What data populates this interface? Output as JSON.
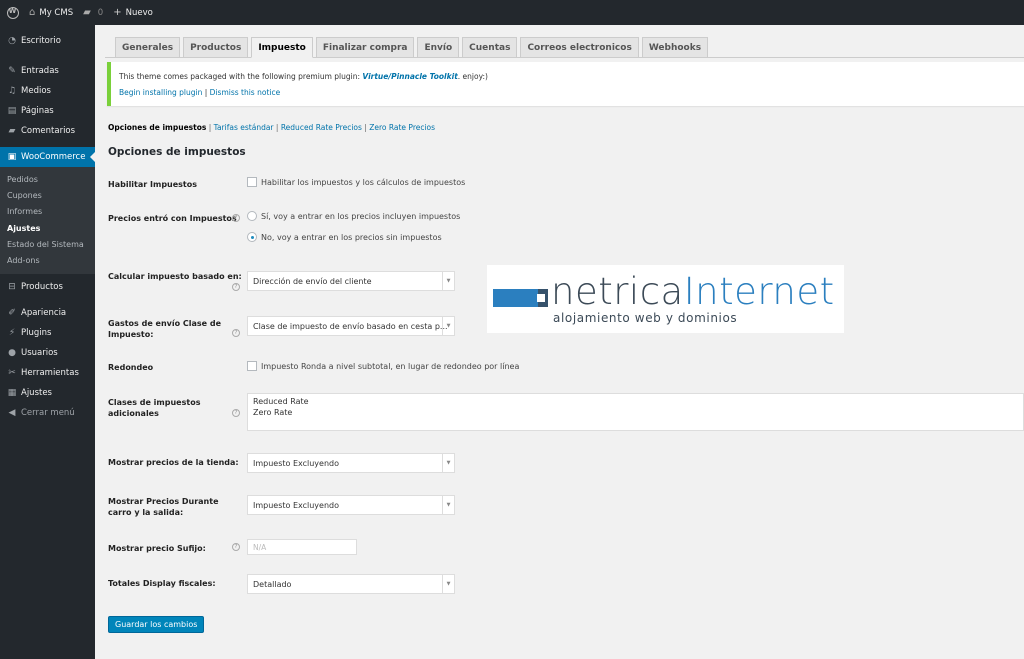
{
  "adminbar": {
    "site_name": "My CMS",
    "comments_count": "0",
    "new_label": "Nuevo"
  },
  "sidebar": {
    "items": [
      {
        "label": "Escritorio",
        "icon": "dashboard-icon"
      },
      {
        "label": "Entradas",
        "icon": "pin-icon"
      },
      {
        "label": "Medios",
        "icon": "media-icon"
      },
      {
        "label": "Páginas",
        "icon": "page-icon"
      },
      {
        "label": "Comentarios",
        "icon": "comment-icon"
      },
      {
        "label": "WooCommerce",
        "icon": "woo-icon"
      }
    ],
    "submenu": [
      "Pedidos",
      "Cupones",
      "Informes",
      "Ajustes",
      "Estado del Sistema",
      "Add-ons"
    ],
    "items2": [
      {
        "label": "Productos",
        "icon": "cart-icon"
      },
      {
        "label": "Apariencia",
        "icon": "brush-icon"
      },
      {
        "label": "Plugins",
        "icon": "plugin-icon"
      },
      {
        "label": "Usuarios",
        "icon": "users-icon"
      },
      {
        "label": "Herramientas",
        "icon": "wrench-icon"
      },
      {
        "label": "Ajustes",
        "icon": "settings-icon"
      },
      {
        "label": "Cerrar menú",
        "icon": "collapse-icon"
      }
    ]
  },
  "tabs": [
    "Generales",
    "Productos",
    "Impuesto",
    "Finalizar compra",
    "Envío",
    "Cuentas",
    "Correos electronicos",
    "Webhooks"
  ],
  "notice": {
    "text_before": "This theme comes packaged with the following premium plugin: ",
    "plugin": "Virtue/Pinnacle Toolkit",
    "text_after": ". enjoy:)",
    "install_link": "Begin installing plugin",
    "separator": " | ",
    "dismiss_link": "Dismiss this notice"
  },
  "subsub": {
    "current": "Opciones de impuestos",
    "links": [
      "Tarifas estándar",
      "Reduced Rate Precios",
      "Zero Rate Precios"
    ]
  },
  "heading": "Opciones de impuestos",
  "fields": {
    "habilitar": {
      "label": "Habilitar Impuestos",
      "option": "Habilitar los impuestos y los cálculos de impuestos",
      "checked": false
    },
    "precios": {
      "label": "Precios entró con Impuestos",
      "option1": "Sí, voy a entrar en los precios incluyen impuestos",
      "option2": "No, voy a entrar en los precios sin impuestos",
      "selected": 2
    },
    "calcular": {
      "label": "Calcular impuesto basado en:",
      "value": "Dirección de envío del cliente"
    },
    "gastos": {
      "label1": "Gastos de envío Clase de",
      "label2": "Impuesto:",
      "value": "Clase de impuesto de envío basado en cesta p..."
    },
    "redondeo": {
      "label": "Redondeo",
      "option": "Impuesto Ronda a nivel subtotal, en lugar de redondeo por línea",
      "checked": false
    },
    "clases": {
      "label1": "Clases de impuestos",
      "label2": "adicionales",
      "line1": "Reduced Rate",
      "line2": "Zero Rate"
    },
    "mostrar_tienda": {
      "label": "Mostrar precios de la tienda:",
      "value": "Impuesto Excluyendo"
    },
    "mostrar_carro": {
      "label1": "Mostrar Precios Durante",
      "label2": "carro y la salida:",
      "value": "Impuesto Excluyendo"
    },
    "sufijo": {
      "label": "Mostrar precio Sufijo:",
      "placeholder": "N/A"
    },
    "totales": {
      "label": "Totales Display fiscales:",
      "value": "Detallado"
    }
  },
  "save_button": "Guardar los cambios",
  "watermark": {
    "name_part1": "netrica",
    "name_part2": "Internet",
    "tagline": "alojamiento web y dominios"
  },
  "colors": {
    "adminbar": "#23282d",
    "accent": "#0073aa",
    "notice_border": "#7ad03a",
    "button": "#0085ba"
  }
}
